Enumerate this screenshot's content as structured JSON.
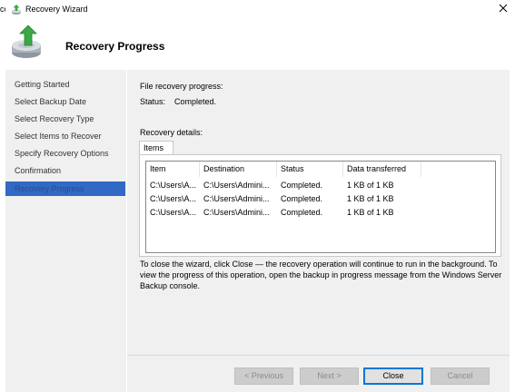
{
  "window": {
    "left_edge_fragment": "cc",
    "title": "Recovery Wizard"
  },
  "page": {
    "title": "Recovery Progress"
  },
  "sidebar": {
    "items": [
      {
        "label": "Getting Started"
      },
      {
        "label": "Select Backup Date"
      },
      {
        "label": "Select Recovery Type"
      },
      {
        "label": "Select Items to Recover"
      },
      {
        "label": "Specify Recovery Options"
      },
      {
        "label": "Confirmation"
      },
      {
        "label": "Recovery Progress",
        "active": true
      }
    ]
  },
  "progress": {
    "heading": "File recovery progress:",
    "status_label": "Status:",
    "status_value": "Completed."
  },
  "details": {
    "heading": "Recovery details:",
    "tab": "Items",
    "columns": [
      "Item",
      "Destination",
      "Status",
      "Data transferred"
    ],
    "rows": [
      [
        "C:\\Users\\A...",
        "C:\\Users\\Admini...",
        "Completed.",
        "1 KB of 1 KB"
      ],
      [
        "C:\\Users\\A...",
        "C:\\Users\\Admini...",
        "Completed.",
        "1 KB of 1 KB"
      ],
      [
        "C:\\Users\\A...",
        "C:\\Users\\Admini...",
        "Completed.",
        "1 KB of 1 KB"
      ]
    ]
  },
  "info_text": "To close the wizard, click Close — the recovery operation will continue to run in the background. To view the progress of this operation, open the backup in progress message from the Windows Server Backup console.",
  "buttons": {
    "previous": "< Previous",
    "next": "Next >",
    "close": "Close",
    "cancel": "Cancel"
  },
  "colors": {
    "selection": "#3169c5",
    "default_button_border": "#0078d7",
    "panel": "#f0f0f0"
  },
  "icons": {
    "app": "backup-restore-icon",
    "header": "backup-restore-icon",
    "close": "close-icon"
  }
}
